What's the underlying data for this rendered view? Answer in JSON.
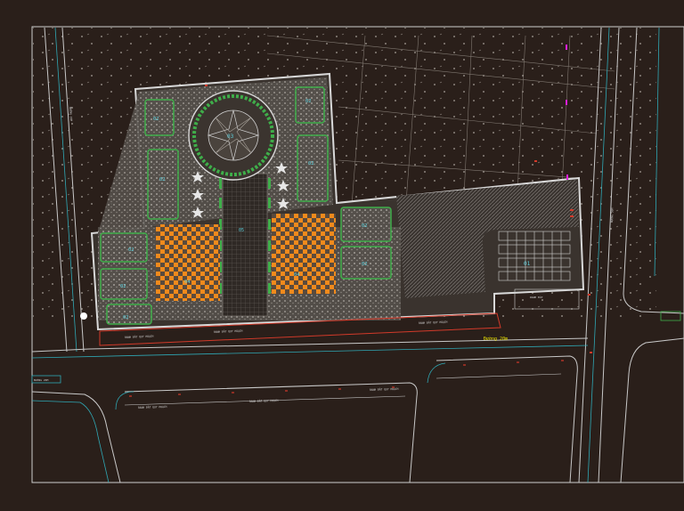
{
  "colors": {
    "background": "#2a1f1a",
    "frame": "#cfcfcf",
    "site_outline": "#d8d8d8",
    "road_edge": "#c8c8c8",
    "curb_cyan": "#2fa8b5",
    "boundary_red": "#d23a2a",
    "grass_green": "#3fae4a",
    "paving_orange": "#f08a1c",
    "label_yellow": "#e8e000",
    "dim_cyan": "#5fd3e0",
    "magenta": "#e020e0"
  },
  "labels": {
    "plaza_dome": "03",
    "bed_left_top": "02",
    "bed_left_mid": "02",
    "bed_left_low": "02",
    "bed_right_top": "02",
    "bed_right_mid": "02",
    "bed_west_1": "02",
    "bed_west_2": "02",
    "bed_west_3": "02",
    "bed_east_1": "02",
    "bed_east_2": "02",
    "paving_left": "04",
    "paving_right": "04",
    "parking": "01",
    "walkway_label": "05",
    "road_name": "Đường 20m",
    "boundary_text_1": "RANH ĐẤT QUY HOẠCH",
    "boundary_text_2": "RANH ĐẤT QUY HOẠCH",
    "boundary_text_3": "RANH ĐẤT QUY HOẠCH",
    "road_text_1": "RANH ĐẤT QUY HOẠCH",
    "road_text_2": "RANH ĐẤT QUY HOẠCH",
    "road_text_3": "RANH ĐẤT QUY HOẠCH",
    "street_left_vertical": "ĐƯỜNG 20M",
    "street_right_vertical": "ĐƯỜNG 30M",
    "street_left_corner": "ĐƯỜNG 20M",
    "parking_strip": "RANH ĐẤT"
  }
}
